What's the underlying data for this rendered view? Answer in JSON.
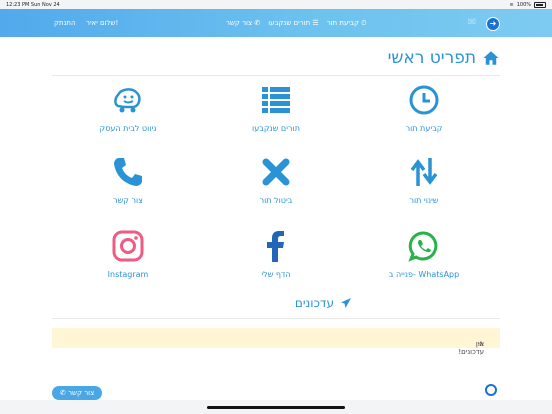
{
  "status_bar": {
    "time_date": "12:23 PM   Sun Nov 24",
    "battery": "100%"
  },
  "navbar": {
    "logout": "התנתק",
    "greeting": "שלום יאיר!",
    "links": [
      "קביעת תור",
      "תורים שנקבעו",
      "צור קשר"
    ]
  },
  "main": {
    "title": "תפריט ראשי",
    "tiles": [
      {
        "label": "קביעת תור"
      },
      {
        "label": "תורים שנקבעו"
      },
      {
        "label": "ניווט לבית העסק"
      },
      {
        "label": "שינוי תור"
      },
      {
        "label": "ביטול תור"
      },
      {
        "label": "צור קשר"
      },
      {
        "label": "פנייה ב- WhatsApp"
      },
      {
        "label": "הדף שלי"
      },
      {
        "label": "Instagram"
      }
    ],
    "updates_title": "עדכונים",
    "no_updates": "אין עדכונים!"
  },
  "footer": {
    "contact_button": "צור קשר"
  },
  "colors": {
    "accent": "#2a93d5",
    "navbar": "#5ab2ee",
    "instagram": "#ef5b83",
    "whatsapp": "#28b24a",
    "alert": "#fff6d6"
  }
}
